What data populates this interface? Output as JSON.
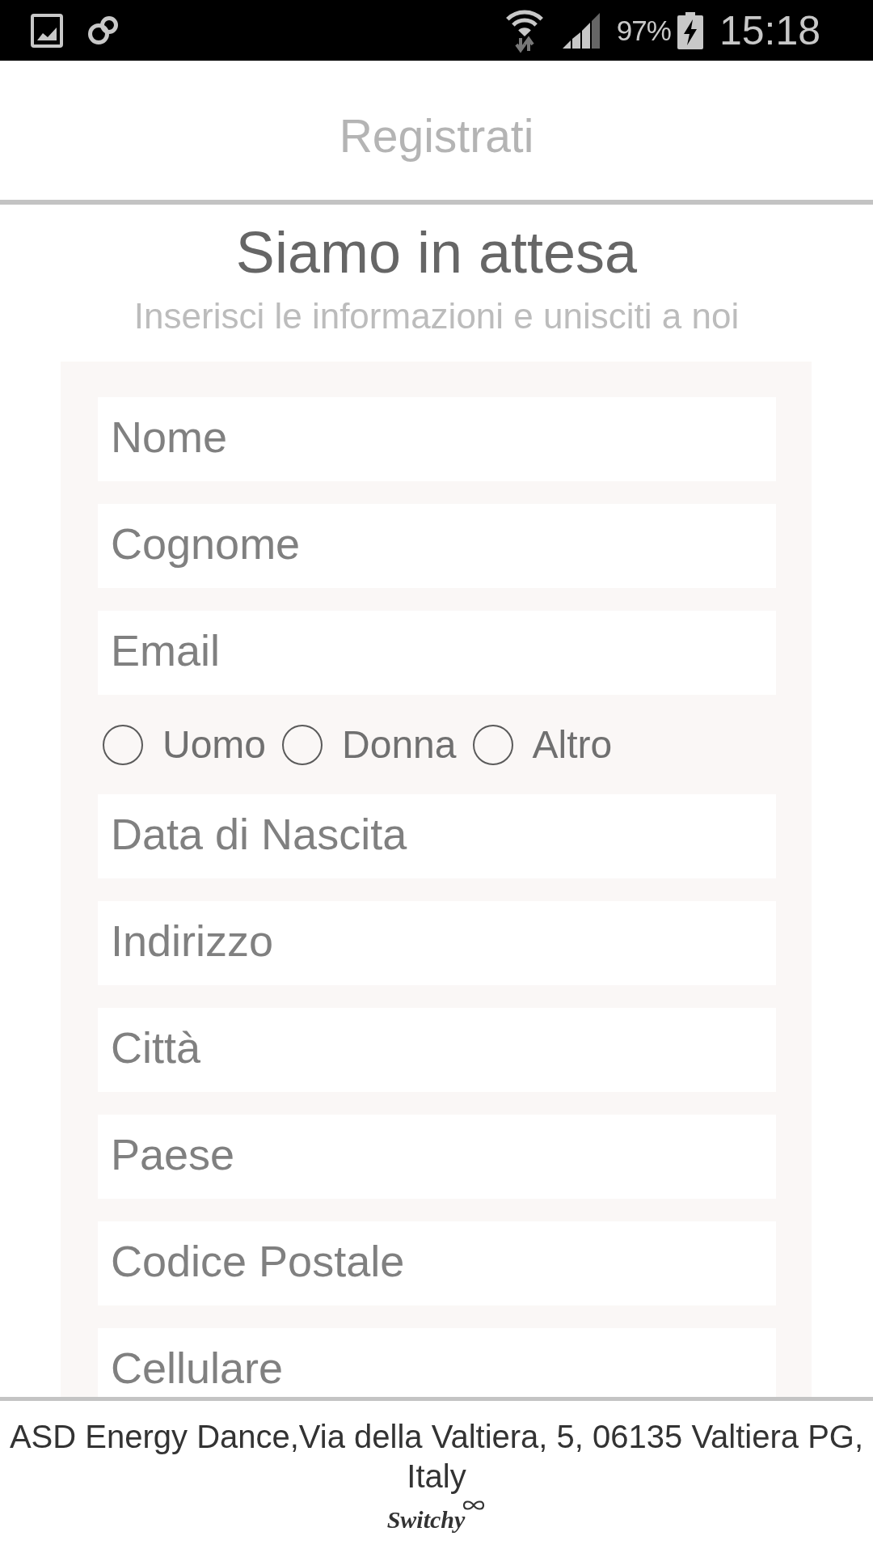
{
  "status_bar": {
    "battery": "97%",
    "time": "15:18"
  },
  "header": {
    "title": "Registrati"
  },
  "intro": {
    "heading": "Siamo in attesa",
    "subheading": "Inserisci le informazioni e unisciti a noi"
  },
  "form": {
    "items": [
      {
        "kind": "text",
        "placeholder": "Nome"
      },
      {
        "kind": "text",
        "placeholder": "Cognome"
      },
      {
        "kind": "text",
        "placeholder": "Email"
      },
      {
        "kind": "radio_group",
        "options": [
          {
            "label": "Uomo",
            "selected": false
          },
          {
            "label": "Donna",
            "selected": false
          },
          {
            "label": "Altro",
            "selected": false
          }
        ]
      },
      {
        "kind": "text",
        "placeholder": "Data di Nascita"
      },
      {
        "kind": "text",
        "placeholder": "Indirizzo"
      },
      {
        "kind": "text",
        "placeholder": "Città"
      },
      {
        "kind": "text",
        "placeholder": "Paese"
      },
      {
        "kind": "text",
        "placeholder": "Codice Postale"
      },
      {
        "kind": "text",
        "placeholder": "Cellulare"
      }
    ]
  },
  "footer": {
    "address": "ASD Energy Dance,Via della Valtiera, 5, 06135 Valtiera PG, Italy",
    "brand": "Switchy"
  }
}
